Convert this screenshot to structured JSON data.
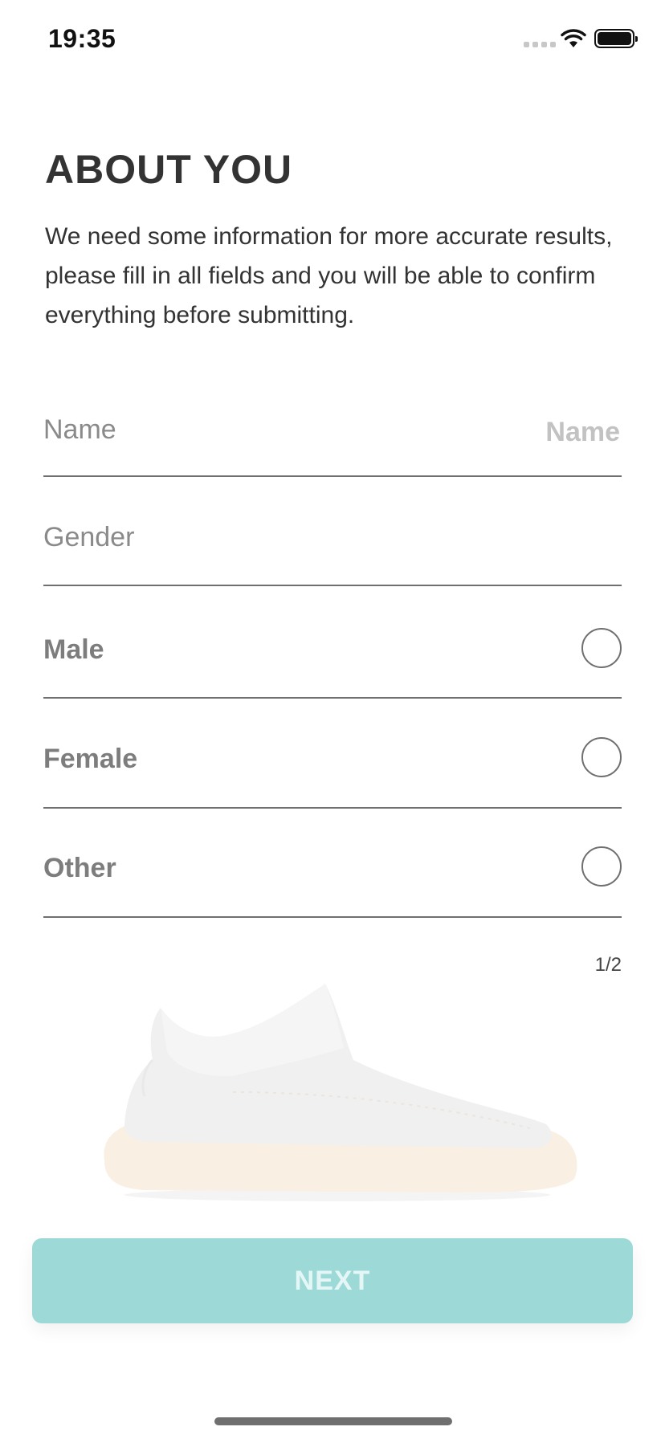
{
  "status_bar": {
    "time": "19:35"
  },
  "header": {
    "title": "ABOUT YOU",
    "description": "We need some information for more accurate results, please fill in all fields and you will be able to confirm everything before submitting."
  },
  "form": {
    "name": {
      "label": "Name",
      "placeholder": "Name",
      "value": ""
    },
    "gender": {
      "label": "Gender",
      "options": [
        {
          "label": "Male",
          "selected": false
        },
        {
          "label": "Female",
          "selected": false
        },
        {
          "label": "Other",
          "selected": false
        }
      ]
    }
  },
  "pager": {
    "text": "1/2"
  },
  "next_button": {
    "label": "NEXT",
    "enabled": false
  },
  "colors": {
    "accent": "#9ddad7",
    "text_primary": "#333333",
    "text_muted": "#8a8a8a",
    "divider": "#6f6f6f"
  },
  "icons": [
    "wifi-icon",
    "battery-icon",
    "cellular-signal-icon",
    "shoe-image"
  ]
}
